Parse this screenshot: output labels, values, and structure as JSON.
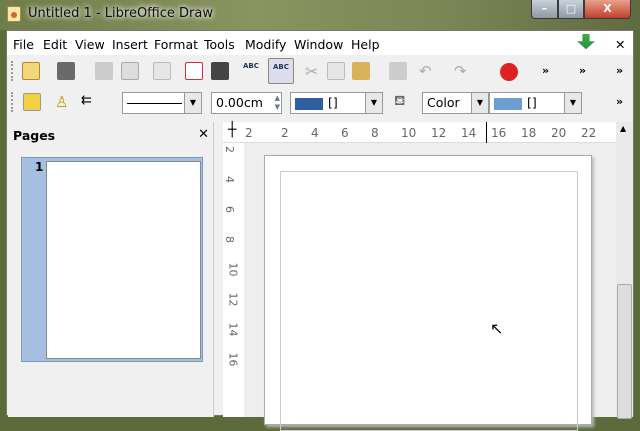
{
  "window": {
    "title": "Untitled 1 - LibreOffice Draw",
    "minimize": "–",
    "maximize": "□",
    "close": "X"
  },
  "menu": [
    "File",
    "Edit",
    "View",
    "Insert",
    "Format",
    "Tools",
    "Modify",
    "Window",
    "Help"
  ],
  "menu_close": "✕",
  "toolbar2": {
    "line_width": "0.00cm",
    "line_color_label": "[]",
    "area_style": "Color",
    "area_color_label": "[]",
    "line_color": "#2e5e9e",
    "area_color": "#6d9ccf"
  },
  "overflow": "»",
  "pages_panel": {
    "title": "Pages",
    "close": "✕",
    "page_number": "1"
  },
  "ruler": {
    "h_ticks": [
      "2",
      "2",
      "4",
      "6",
      "8",
      "10",
      "12",
      "14",
      "16",
      "18",
      "20",
      "22"
    ],
    "v_ticks": [
      "2",
      "4",
      "6",
      "8",
      "10",
      "12",
      "14",
      "16"
    ]
  }
}
